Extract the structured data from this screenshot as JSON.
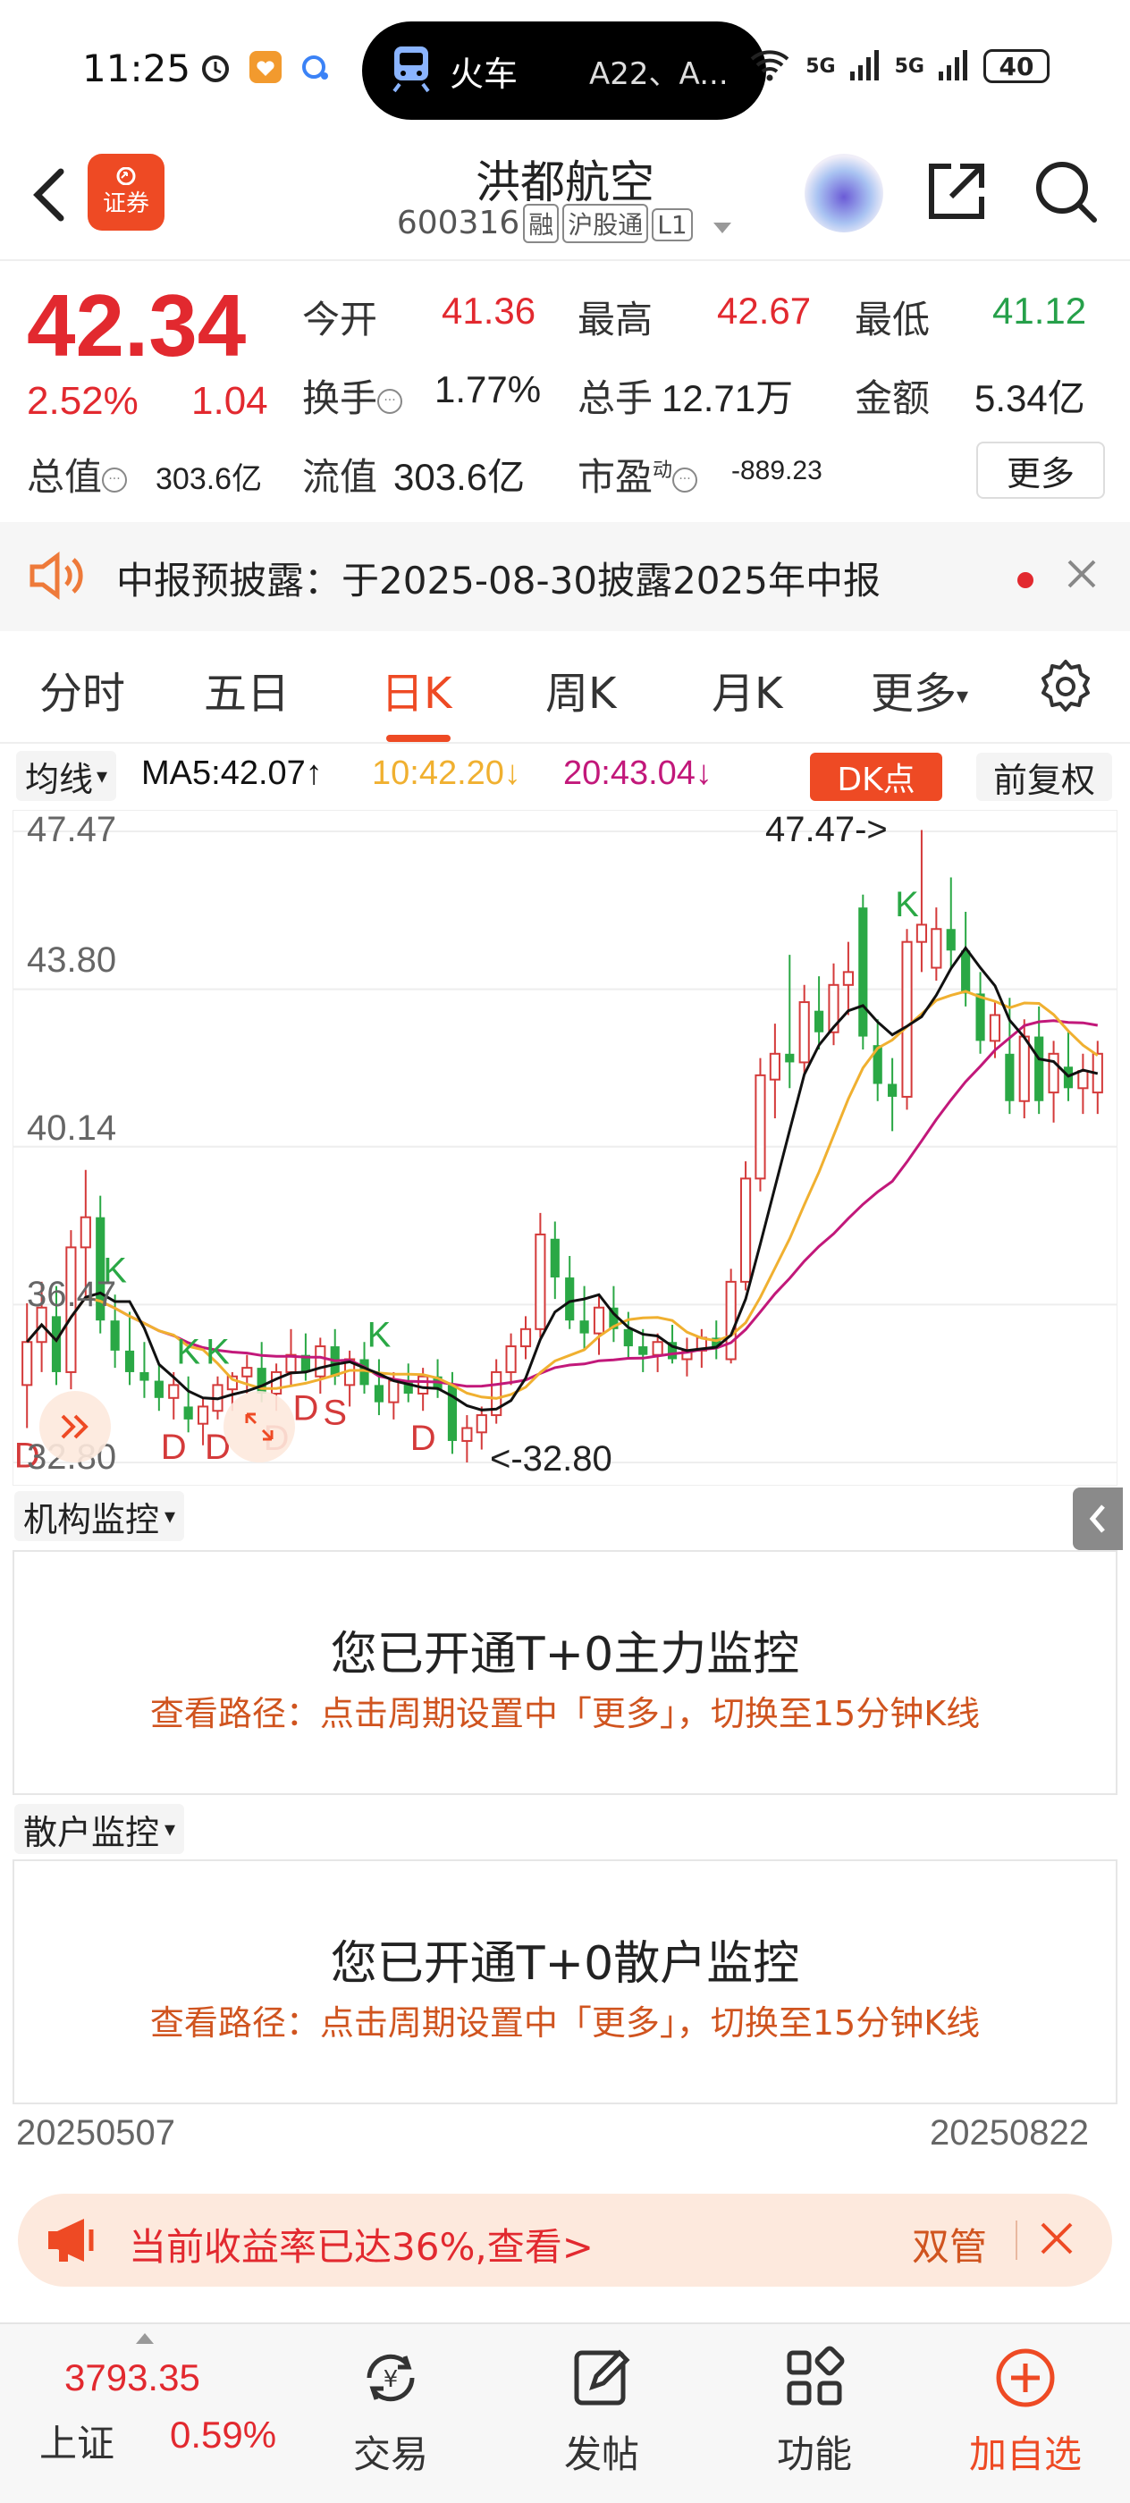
{
  "status_bar": {
    "time": "11:25",
    "pill_title": "火车",
    "pill_sub": "A22、A...",
    "net1": "5G",
    "net2": "5G",
    "battery": "40"
  },
  "header": {
    "brand": "证券",
    "title": "洪都航空",
    "code": "600316",
    "tags": [
      "融",
      "沪股通",
      "L1"
    ]
  },
  "quote": {
    "price": "42.34",
    "change_pct": "2.52%",
    "change_abs": "1.04",
    "open_label": "今开",
    "open_value": "41.36",
    "high_label": "最高",
    "high_value": "42.67",
    "low_label": "最低",
    "low_value": "41.12",
    "turnover_label": "换手",
    "turnover_value": "1.77%",
    "volume_label": "总手",
    "volume_value": "12.71万",
    "amount_label": "金额",
    "amount_value": "5.34亿",
    "mcap_label": "总值",
    "mcap_value": "303.6亿",
    "float_label": "流值",
    "float_value": "303.6亿",
    "pe_label": "市盈",
    "pe_sup": "动",
    "pe_value": "-889.23",
    "more_label": "更多"
  },
  "notice": {
    "text": "中报预披露：于2025-08-30披露2025年中报"
  },
  "tabs": {
    "t1": "分时",
    "t2": "五日",
    "t3": "日K",
    "t4": "周K",
    "t5": "月K",
    "t6": "更多"
  },
  "ma": {
    "select": "均线",
    "ma5": "MA5:42.07↑",
    "ma10": "10:42.20↓",
    "ma20": "20:43.04↓",
    "dk_label": "DK点",
    "adjust_label": "前复权",
    "color_ma5": "#111111",
    "color_ma10": "#f0b030",
    "color_ma20": "#c2187a"
  },
  "chart_data": {
    "type": "candlestick",
    "y_labels": [
      "47.47",
      "43.80",
      "40.14",
      "36.47",
      "32.80"
    ],
    "ylim": [
      32.8,
      47.47
    ],
    "max_annotation": "47.47->",
    "min_annotation": "<-32.80",
    "signals": [
      "D",
      "K",
      "D",
      "K",
      "D",
      "K",
      "D",
      "D",
      "S",
      "K",
      "D",
      "K"
    ],
    "candles": [
      {
        "o": 34.6,
        "h": 36.5,
        "l": 33.6,
        "c": 35.6
      },
      {
        "o": 35.6,
        "h": 37.0,
        "l": 34.9,
        "c": 36.4
      },
      {
        "o": 36.2,
        "h": 36.9,
        "l": 34.6,
        "c": 34.9
      },
      {
        "o": 34.9,
        "h": 38.2,
        "l": 34.5,
        "c": 37.8
      },
      {
        "o": 37.8,
        "h": 39.6,
        "l": 36.6,
        "c": 38.5
      },
      {
        "o": 38.5,
        "h": 39.0,
        "l": 35.8,
        "c": 36.1
      },
      {
        "o": 36.1,
        "h": 36.7,
        "l": 35.0,
        "c": 35.4
      },
      {
        "o": 35.4,
        "h": 36.3,
        "l": 34.6,
        "c": 34.9
      },
      {
        "o": 34.9,
        "h": 35.6,
        "l": 34.3,
        "c": 34.7
      },
      {
        "o": 34.7,
        "h": 35.1,
        "l": 34.0,
        "c": 34.3
      },
      {
        "o": 34.3,
        "h": 34.9,
        "l": 33.8,
        "c": 34.6
      },
      {
        "o": 34.1,
        "h": 34.8,
        "l": 33.5,
        "c": 33.8
      },
      {
        "o": 33.7,
        "h": 34.3,
        "l": 33.2,
        "c": 34.1
      },
      {
        "o": 34.0,
        "h": 34.8,
        "l": 33.8,
        "c": 34.6
      },
      {
        "o": 34.5,
        "h": 34.9,
        "l": 34.0,
        "c": 34.8
      },
      {
        "o": 34.8,
        "h": 35.3,
        "l": 34.4,
        "c": 35.0
      },
      {
        "o": 35.0,
        "h": 35.6,
        "l": 34.2,
        "c": 34.4
      },
      {
        "o": 34.4,
        "h": 35.1,
        "l": 34.0,
        "c": 34.9
      },
      {
        "o": 34.9,
        "h": 35.9,
        "l": 34.6,
        "c": 35.3
      },
      {
        "o": 35.3,
        "h": 35.8,
        "l": 34.7,
        "c": 34.9
      },
      {
        "o": 34.8,
        "h": 35.7,
        "l": 34.4,
        "c": 35.5
      },
      {
        "o": 35.5,
        "h": 35.9,
        "l": 34.6,
        "c": 34.8
      },
      {
        "o": 34.6,
        "h": 35.4,
        "l": 34.1,
        "c": 35.2
      },
      {
        "o": 35.2,
        "h": 35.6,
        "l": 34.4,
        "c": 34.6
      },
      {
        "o": 34.6,
        "h": 35.2,
        "l": 33.9,
        "c": 34.2
      },
      {
        "o": 34.2,
        "h": 34.9,
        "l": 33.8,
        "c": 34.7
      },
      {
        "o": 34.7,
        "h": 35.1,
        "l": 34.2,
        "c": 34.4
      },
      {
        "o": 34.4,
        "h": 35.0,
        "l": 34.0,
        "c": 34.8
      },
      {
        "o": 34.8,
        "h": 35.2,
        "l": 34.3,
        "c": 34.5
      },
      {
        "o": 34.6,
        "h": 34.9,
        "l": 33.0,
        "c": 33.3
      },
      {
        "o": 33.3,
        "h": 33.9,
        "l": 32.8,
        "c": 33.6
      },
      {
        "o": 33.5,
        "h": 34.1,
        "l": 33.1,
        "c": 33.9
      },
      {
        "o": 33.9,
        "h": 35.2,
        "l": 33.7,
        "c": 34.9
      },
      {
        "o": 34.9,
        "h": 35.8,
        "l": 34.6,
        "c": 35.5
      },
      {
        "o": 35.5,
        "h": 36.2,
        "l": 35.2,
        "c": 35.9
      },
      {
        "o": 35.9,
        "h": 38.6,
        "l": 35.7,
        "c": 38.1
      },
      {
        "o": 38.0,
        "h": 38.4,
        "l": 36.6,
        "c": 37.1
      },
      {
        "o": 37.1,
        "h": 37.6,
        "l": 35.9,
        "c": 36.1
      },
      {
        "o": 36.1,
        "h": 36.9,
        "l": 35.4,
        "c": 35.8
      },
      {
        "o": 35.8,
        "h": 36.7,
        "l": 35.3,
        "c": 36.4
      },
      {
        "o": 36.4,
        "h": 36.9,
        "l": 35.6,
        "c": 35.9
      },
      {
        "o": 35.9,
        "h": 36.3,
        "l": 35.2,
        "c": 35.5
      },
      {
        "o": 35.5,
        "h": 35.9,
        "l": 34.9,
        "c": 35.3
      },
      {
        "o": 35.3,
        "h": 35.8,
        "l": 34.9,
        "c": 35.6
      },
      {
        "o": 35.6,
        "h": 36.0,
        "l": 35.1,
        "c": 35.2
      },
      {
        "o": 35.2,
        "h": 35.7,
        "l": 34.8,
        "c": 35.4
      },
      {
        "o": 35.4,
        "h": 35.9,
        "l": 35.0,
        "c": 35.7
      },
      {
        "o": 35.7,
        "h": 36.1,
        "l": 35.2,
        "c": 35.5
      },
      {
        "o": 35.2,
        "h": 37.3,
        "l": 35.1,
        "c": 37.0
      },
      {
        "o": 37.0,
        "h": 39.8,
        "l": 36.8,
        "c": 39.4
      },
      {
        "o": 39.4,
        "h": 42.2,
        "l": 39.1,
        "c": 41.8
      },
      {
        "o": 41.7,
        "h": 43.0,
        "l": 40.8,
        "c": 42.3
      },
      {
        "o": 42.3,
        "h": 44.6,
        "l": 41.5,
        "c": 42.1
      },
      {
        "o": 42.1,
        "h": 43.9,
        "l": 41.8,
        "c": 43.5
      },
      {
        "o": 43.3,
        "h": 44.1,
        "l": 42.4,
        "c": 42.8
      },
      {
        "o": 42.8,
        "h": 44.4,
        "l": 42.5,
        "c": 43.9
      },
      {
        "o": 43.9,
        "h": 44.9,
        "l": 43.2,
        "c": 44.2
      },
      {
        "o": 45.7,
        "h": 46.0,
        "l": 42.4,
        "c": 42.7
      },
      {
        "o": 42.5,
        "h": 43.1,
        "l": 41.2,
        "c": 41.6
      },
      {
        "o": 41.6,
        "h": 42.2,
        "l": 40.5,
        "c": 41.3
      },
      {
        "o": 41.3,
        "h": 45.2,
        "l": 41.0,
        "c": 44.9
      },
      {
        "o": 44.9,
        "h": 47.5,
        "l": 44.2,
        "c": 45.3
      },
      {
        "o": 44.3,
        "h": 45.7,
        "l": 44.0,
        "c": 45.2
      },
      {
        "o": 45.2,
        "h": 46.4,
        "l": 44.3,
        "c": 44.7
      },
      {
        "o": 44.7,
        "h": 45.6,
        "l": 43.4,
        "c": 43.7
      },
      {
        "o": 43.7,
        "h": 44.2,
        "l": 42.3,
        "c": 42.6
      },
      {
        "o": 42.6,
        "h": 43.5,
        "l": 42.2,
        "c": 43.2
      },
      {
        "o": 42.3,
        "h": 43.6,
        "l": 40.9,
        "c": 41.2
      },
      {
        "o": 41.2,
        "h": 43.1,
        "l": 40.8,
        "c": 42.7
      },
      {
        "o": 42.7,
        "h": 43.4,
        "l": 40.9,
        "c": 41.2
      },
      {
        "o": 41.4,
        "h": 42.6,
        "l": 40.7,
        "c": 42.3
      },
      {
        "o": 42.0,
        "h": 42.8,
        "l": 41.2,
        "c": 41.5
      },
      {
        "o": 41.5,
        "h": 42.3,
        "l": 40.9,
        "c": 41.9
      },
      {
        "o": 41.4,
        "h": 42.6,
        "l": 40.9,
        "c": 42.3
      }
    ]
  },
  "monitors": {
    "inst_label": "机构监控",
    "inst_title": "您已开通T+0主力监控",
    "inst_hint": "查看路径：点击周期设置中「更多」，切换至15分钟K线",
    "retail_label": "散户监控",
    "retail_title": "您已开通T+0散户监控",
    "retail_hint": "查看路径：点击周期设置中「更多」，切换至15分钟K线"
  },
  "dates": {
    "start": "20250507",
    "end": "20250822"
  },
  "promo": {
    "text": "当前收益率已达36%,查看>",
    "right": "双管"
  },
  "bottom": {
    "index_value": "3793.35",
    "index_name": "上证",
    "index_pct": "0.59%",
    "nav_trade": "交易",
    "nav_post": "发帖",
    "nav_func": "功能",
    "nav_add": "加自选"
  }
}
